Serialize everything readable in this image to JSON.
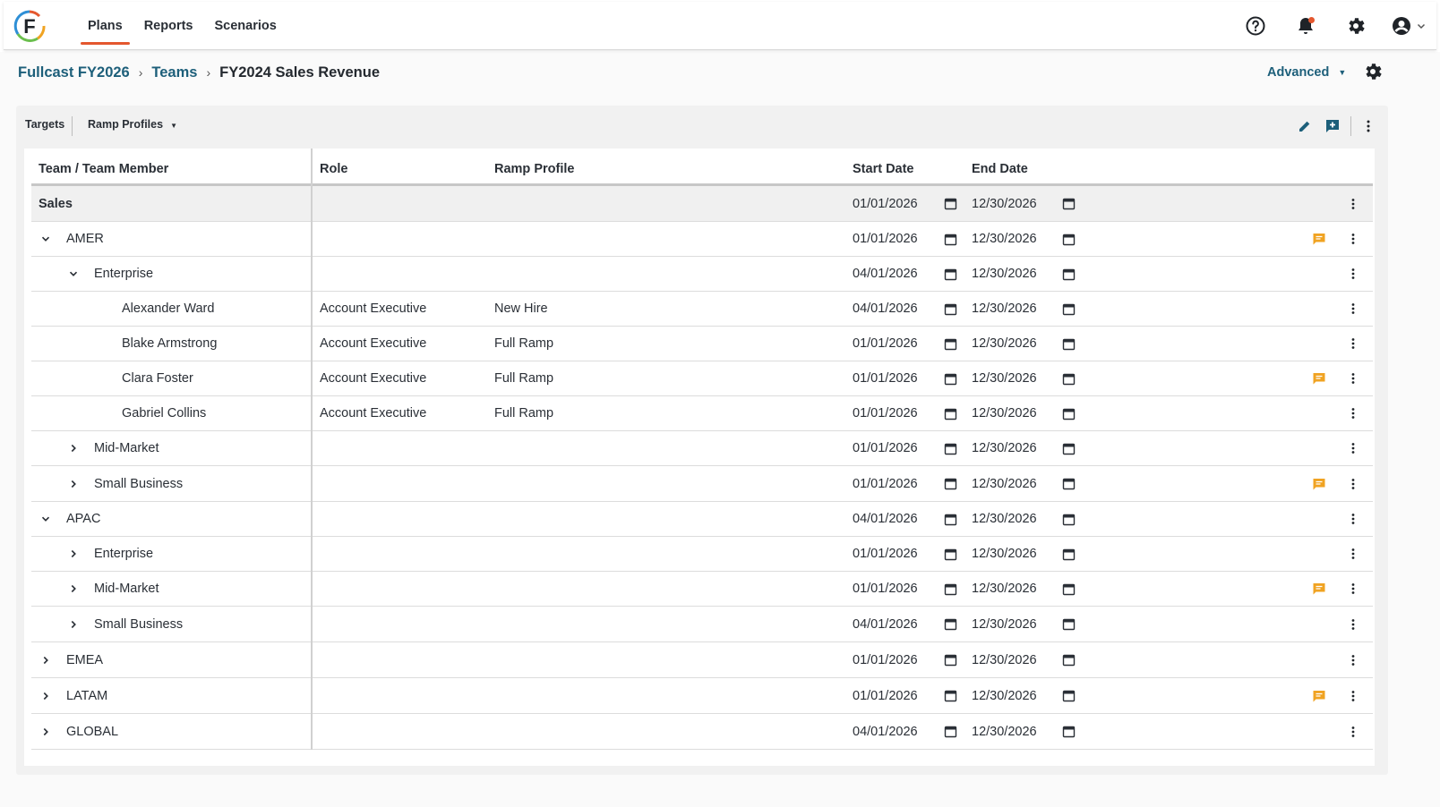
{
  "app": {
    "logo_letter": "F"
  },
  "nav": [
    {
      "label": "Plans",
      "active": true
    },
    {
      "label": "Reports",
      "active": false
    },
    {
      "label": "Scenarios",
      "active": false
    }
  ],
  "top_icons": [
    "help-icon",
    "bell-icon",
    "gear-icon",
    "account-icon"
  ],
  "breadcrumb": {
    "items": [
      "Fullcast FY2026",
      "Teams"
    ],
    "current": "FY2024 Sales Revenue",
    "separator": "›"
  },
  "advanced_label": "Advanced",
  "toolbar": {
    "tab_targets": "Targets",
    "tab_ramp_profiles": "Ramp Profiles"
  },
  "columns": {
    "team_member": "Team / Team Member",
    "role": "Role",
    "ramp_profile": "Ramp Profile",
    "start_date": "Start Date",
    "end_date": "End Date"
  },
  "colors": {
    "accent": "#e4572e",
    "link": "#1d5f7a",
    "comment": "#f0a322"
  },
  "rows": [
    {
      "name": "Sales",
      "level": 0,
      "toggle": "none",
      "role": "",
      "ramp": "",
      "start": "01/01/2026",
      "end": "12/30/2026",
      "comment": false
    },
    {
      "name": "AMER",
      "level": 1,
      "toggle": "expanded",
      "role": "",
      "ramp": "",
      "start": "01/01/2026",
      "end": "12/30/2026",
      "comment": true
    },
    {
      "name": "Enterprise",
      "level": 2,
      "toggle": "expanded",
      "role": "",
      "ramp": "",
      "start": "04/01/2026",
      "end": "12/30/2026",
      "comment": false
    },
    {
      "name": "Alexander Ward",
      "level": 3,
      "toggle": "none",
      "role": "Account Executive",
      "ramp": "New Hire",
      "start": "04/01/2026",
      "end": "12/30/2026",
      "comment": false
    },
    {
      "name": "Blake Armstrong",
      "level": 3,
      "toggle": "none",
      "role": "Account Executive",
      "ramp": "Full Ramp",
      "start": "01/01/2026",
      "end": "12/30/2026",
      "comment": false
    },
    {
      "name": "Clara Foster",
      "level": 3,
      "toggle": "none",
      "role": "Account Executive",
      "ramp": "Full Ramp",
      "start": "01/01/2026",
      "end": "12/30/2026",
      "comment": true
    },
    {
      "name": "Gabriel Collins",
      "level": 3,
      "toggle": "none",
      "role": "Account Executive",
      "ramp": "Full Ramp",
      "start": "01/01/2026",
      "end": "12/30/2026",
      "comment": false
    },
    {
      "name": "Mid-Market",
      "level": 2,
      "toggle": "collapsed",
      "role": "",
      "ramp": "",
      "start": "01/01/2026",
      "end": "12/30/2026",
      "comment": false
    },
    {
      "name": "Small Business",
      "level": 2,
      "toggle": "collapsed",
      "role": "",
      "ramp": "",
      "start": "01/01/2026",
      "end": "12/30/2026",
      "comment": true
    },
    {
      "name": "APAC",
      "level": 1,
      "toggle": "expanded",
      "role": "",
      "ramp": "",
      "start": "04/01/2026",
      "end": "12/30/2026",
      "comment": false
    },
    {
      "name": "Enterprise",
      "level": 2,
      "toggle": "collapsed",
      "role": "",
      "ramp": "",
      "start": "01/01/2026",
      "end": "12/30/2026",
      "comment": false
    },
    {
      "name": "Mid-Market",
      "level": 2,
      "toggle": "collapsed",
      "role": "",
      "ramp": "",
      "start": "01/01/2026",
      "end": "12/30/2026",
      "comment": true
    },
    {
      "name": "Small Business",
      "level": 2,
      "toggle": "collapsed",
      "role": "",
      "ramp": "",
      "start": "04/01/2026",
      "end": "12/30/2026",
      "comment": false
    },
    {
      "name": "EMEA",
      "level": 1,
      "toggle": "collapsed",
      "role": "",
      "ramp": "",
      "start": "01/01/2026",
      "end": "12/30/2026",
      "comment": false
    },
    {
      "name": "LATAM",
      "level": 1,
      "toggle": "collapsed",
      "role": "",
      "ramp": "",
      "start": "01/01/2026",
      "end": "12/30/2026",
      "comment": true
    },
    {
      "name": "GLOBAL",
      "level": 1,
      "toggle": "collapsed",
      "role": "",
      "ramp": "",
      "start": "04/01/2026",
      "end": "12/30/2026",
      "comment": false
    }
  ]
}
